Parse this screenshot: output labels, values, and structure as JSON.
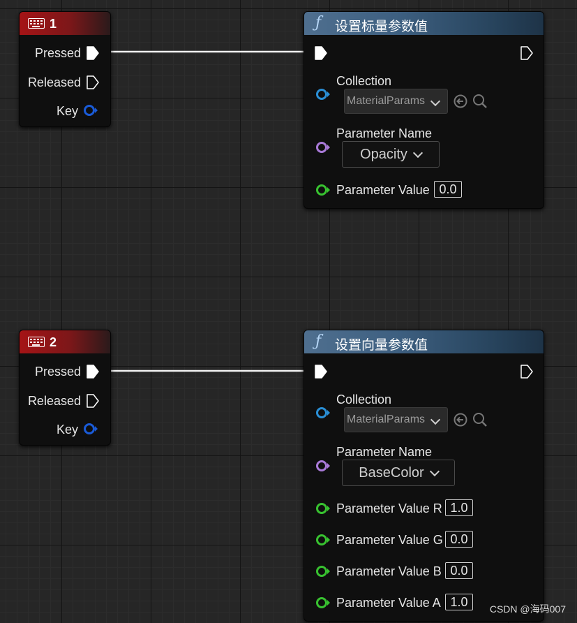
{
  "nodes": {
    "key1": {
      "title": "1",
      "pins": {
        "pressed": "Pressed",
        "released": "Released",
        "key": "Key"
      }
    },
    "key2": {
      "title": "2",
      "pins": {
        "pressed": "Pressed",
        "released": "Released",
        "key": "Key"
      }
    },
    "scalar": {
      "title": "设置标量参数值",
      "collection_label": "Collection",
      "collection_value": "MaterialParams",
      "param_name_label": "Parameter Name",
      "param_name_value": "Opacity",
      "value_label": "Parameter Value",
      "value": "0.0"
    },
    "vector": {
      "title": "设置向量参数值",
      "collection_label": "Collection",
      "collection_value": "MaterialParams",
      "param_name_label": "Parameter Name",
      "param_name_value": "BaseColor",
      "values": [
        {
          "label": "Parameter Value R",
          "value": "1.0"
        },
        {
          "label": "Parameter Value G",
          "value": "0.0"
        },
        {
          "label": "Parameter Value B",
          "value": "0.0"
        },
        {
          "label": "Parameter Value A",
          "value": "1.0"
        }
      ]
    }
  },
  "colors": {
    "exec": "#ffffff",
    "key_pin": "#1a5bd8",
    "collection_pin": "#2a8fd6",
    "name_pin": "#a97ad8",
    "float_pin": "#38c230"
  },
  "icons": {
    "key_event": "keyboard-icon",
    "function": "function-icon",
    "browse": "browse-back-icon",
    "search": "search-icon"
  },
  "watermark": "CSDN @海码007"
}
